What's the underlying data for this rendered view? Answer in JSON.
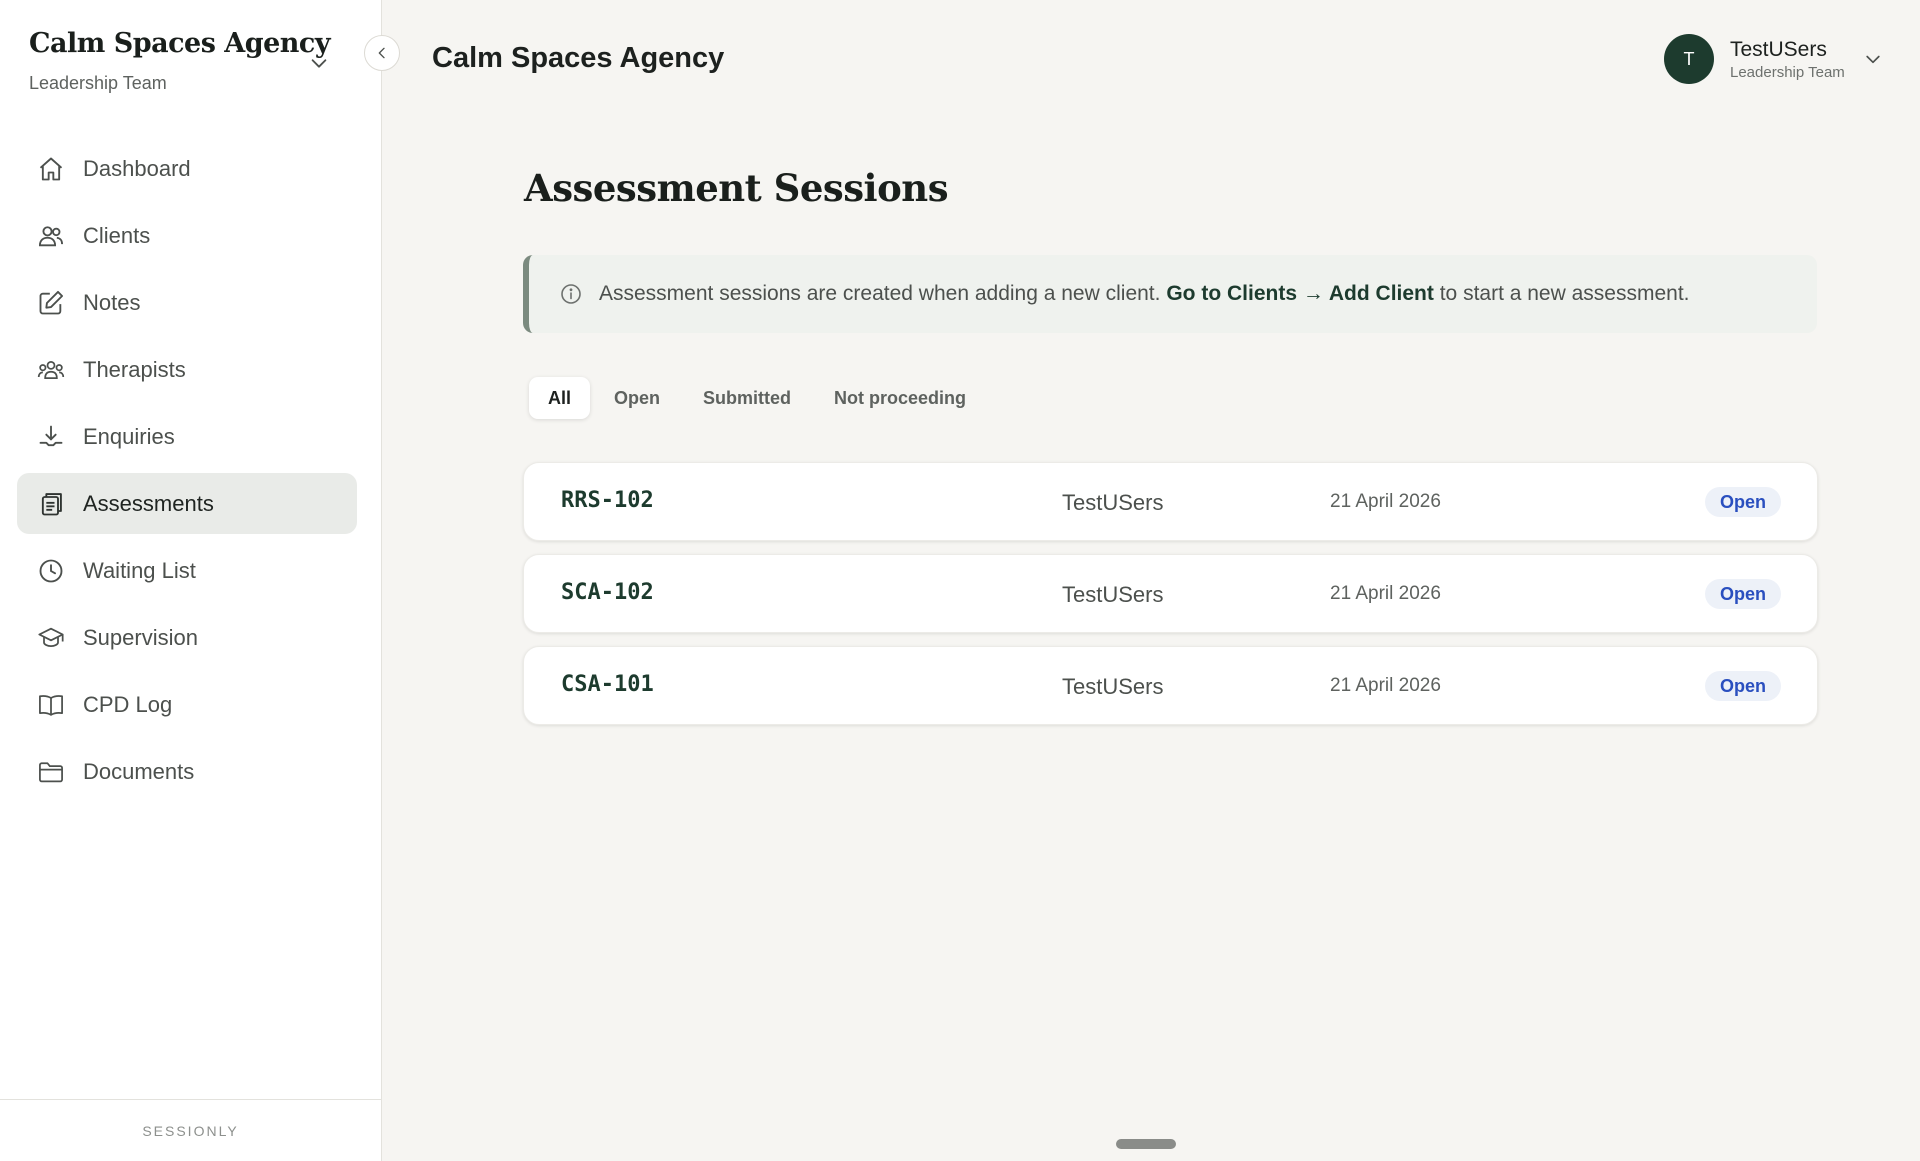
{
  "sidebar": {
    "org_name": "Calm Spaces Agency",
    "org_sub": "Leadership Team",
    "items": [
      {
        "label": "Dashboard",
        "icon": "home-icon"
      },
      {
        "label": "Clients",
        "icon": "users-icon"
      },
      {
        "label": "Notes",
        "icon": "pencil-square-icon"
      },
      {
        "label": "Therapists",
        "icon": "group-icon"
      },
      {
        "label": "Enquiries",
        "icon": "download-tray-icon"
      },
      {
        "label": "Assessments",
        "icon": "clipboard-icon",
        "active": true
      },
      {
        "label": "Waiting List",
        "icon": "clock-icon"
      },
      {
        "label": "Supervision",
        "icon": "graduation-cap-icon"
      },
      {
        "label": "CPD Log",
        "icon": "book-icon"
      },
      {
        "label": "Documents",
        "icon": "folder-icon"
      }
    ],
    "footer": "SESSIONLY"
  },
  "header": {
    "title": "Calm Spaces Agency",
    "user": {
      "initial": "T",
      "name": "TestUSers",
      "role": "Leadership Team"
    }
  },
  "main": {
    "page_title": "Assessment Sessions",
    "info": {
      "text_before": "Assessment sessions are created when adding a new client.",
      "link_text": "Go to Clients → Add Client",
      "text_after": "to start a new assessment."
    },
    "tabs": [
      {
        "label": "All",
        "active": true
      },
      {
        "label": "Open"
      },
      {
        "label": "Submitted"
      },
      {
        "label": "Not proceeding"
      }
    ],
    "sessions": [
      {
        "code": "RRS-102",
        "user": "TestUSers",
        "date": "21 April 2026",
        "status": "Open"
      },
      {
        "code": "SCA-102",
        "user": "TestUSers",
        "date": "21 April 2026",
        "status": "Open"
      },
      {
        "code": "CSA-101",
        "user": "TestUSers",
        "date": "21 April 2026",
        "status": "Open"
      }
    ]
  },
  "colors": {
    "brand_dark": "#1d3b2e",
    "status_open": "#2a4fbf",
    "background": "#f6f5f2"
  }
}
